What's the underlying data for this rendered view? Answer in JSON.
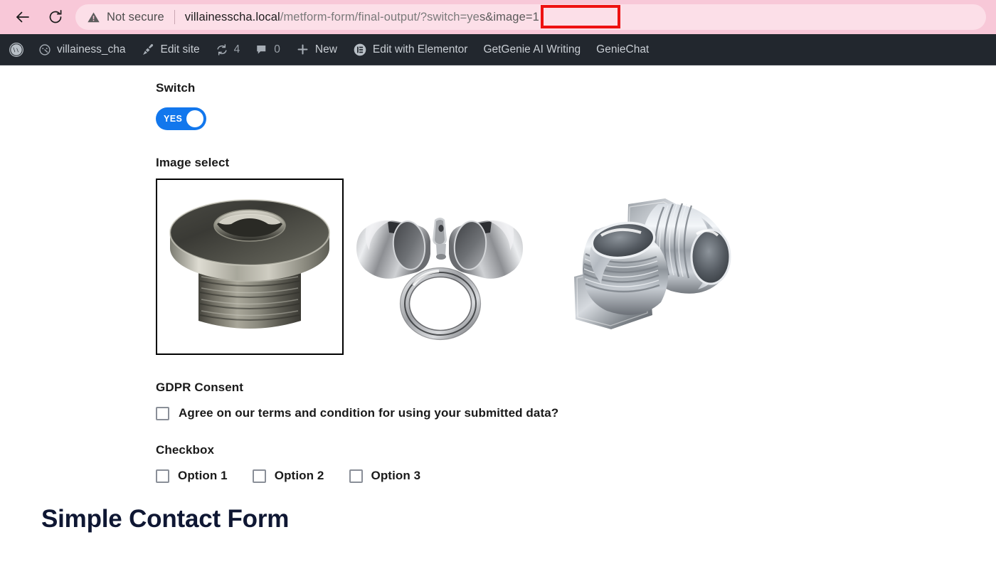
{
  "browser": {
    "back_icon": "back-arrow-icon",
    "reload_icon": "reload-icon",
    "security_icon": "warning-triangle-icon",
    "security_label": "Not secure",
    "url_host": "villainesscha.local",
    "url_path": "/metform-form/final-output/?switch=ye",
    "url_highlight_prefix": "s",
    "url_highlight": "&image=1",
    "url_full": "villainesscha.local/metform-form/final-output/?switch=yes&image=1",
    "annotation_color": "#ee1111"
  },
  "adminbar": {
    "background": "#22272e",
    "items": [
      {
        "name": "wordpress-logo",
        "icon": "wordpress-icon",
        "label": ""
      },
      {
        "name": "site-name",
        "icon": "dashboard-icon",
        "label": "villainess_cha"
      },
      {
        "name": "edit-site",
        "icon": "paintbrush-icon",
        "label": "Edit site"
      },
      {
        "name": "updates",
        "icon": "updates-icon",
        "label": "4"
      },
      {
        "name": "comments",
        "icon": "comment-bubble-icon",
        "label": "0"
      },
      {
        "name": "new-content",
        "icon": "plus-icon",
        "label": "New"
      },
      {
        "name": "edit-with-elementor",
        "icon": "elementor-icon",
        "label": "Edit with Elementor"
      },
      {
        "name": "getgenie-ai-writing",
        "icon": "",
        "label": "GetGenie AI Writing"
      },
      {
        "name": "geniechat",
        "icon": "",
        "label": "GenieChat"
      }
    ]
  },
  "form": {
    "switch": {
      "label": "Switch",
      "value": "YES",
      "checked": true,
      "accent": "#1277ed"
    },
    "image_select": {
      "label": "Image select",
      "options": [
        {
          "alt": "hex-socket-plug-bolt",
          "selected": true
        },
        {
          "alt": "two-hex-bushings-fitting-and-ring",
          "selected": false
        },
        {
          "alt": "two-jic-flare-fittings",
          "selected": false
        }
      ]
    },
    "gdpr": {
      "label": "GDPR Consent",
      "consent_text": "Agree on our terms and condition for using your submitted data?",
      "checked": false
    },
    "checkbox": {
      "label": "Checkbox",
      "options": [
        {
          "label": "Option 1",
          "checked": false
        },
        {
          "label": "Option 2",
          "checked": false
        },
        {
          "label": "Option 3",
          "checked": false
        }
      ]
    }
  },
  "page": {
    "contact_heading": "Simple Contact Form",
    "heading_color": "#0f1733"
  }
}
